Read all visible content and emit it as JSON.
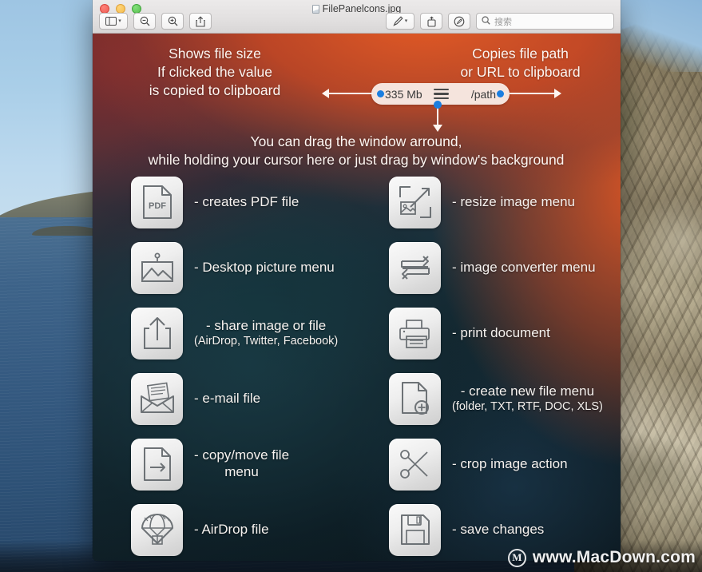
{
  "window": {
    "title": "FilePanelcons.jpg",
    "title_icon": "jpeg-document-icon",
    "traffic_lights": [
      {
        "name": "close",
        "color": "#ec5f56"
      },
      {
        "name": "minimize",
        "color": "#f4bd4e"
      },
      {
        "name": "zoom",
        "color": "#5ac051"
      }
    ],
    "toolbar": {
      "left_buttons": [
        {
          "name": "sidebar-toggle",
          "icon": "sidebar-icon",
          "has_caret": true
        },
        {
          "name": "zoom-out",
          "icon": "magnifier-minus-icon",
          "has_caret": false
        },
        {
          "name": "zoom-in",
          "icon": "magnifier-plus-icon",
          "has_caret": false
        },
        {
          "name": "share",
          "icon": "share-box-arrow-up-icon",
          "has_caret": false
        }
      ],
      "right_buttons": [
        {
          "name": "markup",
          "icon": "pen-markup-icon",
          "has_caret": true
        },
        {
          "name": "rotate",
          "icon": "rotate-left-icon",
          "has_caret": false
        },
        {
          "name": "annotate",
          "icon": "circled-pen-icon",
          "has_caret": false
        }
      ],
      "search": {
        "placeholder": "搜索",
        "value": "",
        "icon": "search-icon"
      }
    }
  },
  "photo": {
    "annotations": {
      "left": "Shows file size\nIf clicked the value\nis copied to clipboard",
      "right": "Copies file path\nor URL to clipboard",
      "bottom": "You can drag the window arround,\nwhile holding your cursor here or just drag by window's background"
    },
    "pill": {
      "size_label": "335 Mb",
      "path_label": "/path",
      "dot_color": "#1a7ee0",
      "menu_icon": "hamburger-menu-icon"
    },
    "left_column": [
      {
        "icon": "pdf-file-icon",
        "label": "- creates PDF file",
        "sub": "",
        "center": false
      },
      {
        "icon": "picture-frame-icon",
        "label": "- Desktop picture menu",
        "sub": "",
        "center": false
      },
      {
        "icon": "share-upload-icon",
        "label": "- share image or file",
        "sub": "(AirDrop, Twitter, Facebook)",
        "center": true
      },
      {
        "icon": "envelope-mail-icon",
        "label": "- e-mail file",
        "sub": "",
        "center": false
      },
      {
        "icon": "file-arrow-right-icon",
        "label": "- copy/move file\nmenu",
        "sub": "",
        "center": true
      },
      {
        "icon": "airdrop-parachute-icon",
        "label": "- AirDrop file",
        "sub": "",
        "center": false
      }
    ],
    "right_column": [
      {
        "icon": "resize-image-icon",
        "label": "- resize image menu",
        "sub": "",
        "center": false
      },
      {
        "icon": "convert-arrows-icon",
        "label": "- image converter menu",
        "sub": "",
        "center": false
      },
      {
        "icon": "printer-icon",
        "label": "- print document",
        "sub": "",
        "center": false
      },
      {
        "icon": "file-plus-icon",
        "label": "- create new file menu",
        "sub": "(folder, TXT, RTF, DOC, XLS)",
        "center": true
      },
      {
        "icon": "scissors-icon",
        "label": "- crop image action",
        "sub": "",
        "center": false
      },
      {
        "icon": "floppy-save-icon",
        "label": "- save changes",
        "sub": "",
        "center": false
      }
    ]
  },
  "watermark": {
    "logo_letter": "M",
    "text": "www.MacDown.com"
  }
}
